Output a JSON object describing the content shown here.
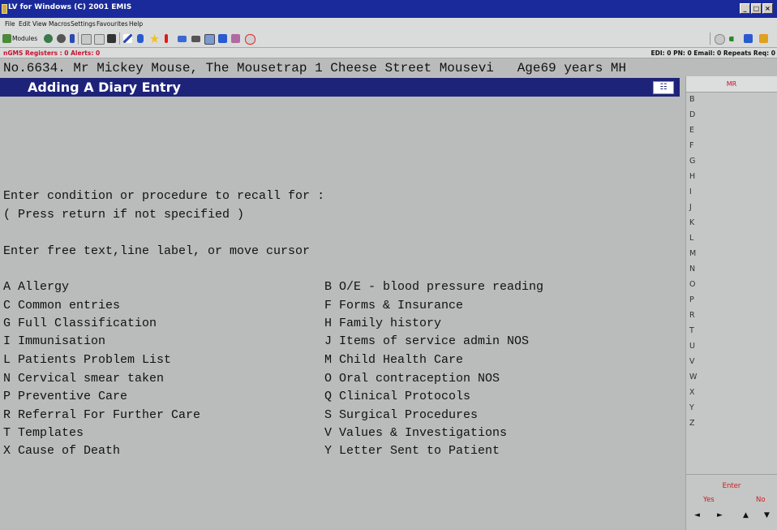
{
  "window": {
    "title": "LV for Windows (C) 2001 EMIS",
    "controls": [
      "_",
      "□",
      "×"
    ]
  },
  "menu": [
    "File",
    "Edit",
    "View",
    "Macros",
    "Settings",
    "Favourites",
    "Help"
  ],
  "toolbar": {
    "modules_label": "Modules"
  },
  "status": {
    "left": "nGMS Registers : 0  Alerts: 0",
    "right": "EDI: 0  PN: 0  Email: 0  Repeats Req: 0"
  },
  "patient_line": "No.6634. Mr Mickey Mouse, The Mousetrap 1 Cheese Street Mousevi   Age69 years MH",
  "screen": {
    "title": "Adding A Diary Entry",
    "prompt1": "Enter condition or procedure to recall for :",
    "prompt2": "( Press return if not specified )",
    "prompt3": "Enter free text,line label, or move cursor",
    "left_options": [
      "A Allergy",
      "C Common entries",
      "G Full Classification",
      "I Immunisation",
      "L Patients Problem List",
      "N Cervical smear taken",
      "P Preventive Care",
      "R Referral For Further Care",
      "T Templates",
      "X Cause of Death"
    ],
    "right_options": [
      "B O/E - blood pressure reading",
      "F Forms & Insurance",
      "H Family history",
      "J Items of service admin NOS",
      "M Child Health Care",
      "O Oral contraception NOS",
      "Q Clinical Protocols",
      "S Surgical Procedures",
      "V Values & Investigations",
      "Y Letter Sent to Patient"
    ]
  },
  "side_panel": {
    "header": "MR",
    "letters": [
      "B",
      "D",
      "E",
      "F",
      "G",
      "H",
      "I",
      "J",
      "K",
      "L",
      "M",
      "N",
      "O",
      "P",
      "R",
      "T",
      "U",
      "V",
      "W",
      "X",
      "Y",
      "Z"
    ],
    "enter_label": "Enter",
    "yes_label": "Yes",
    "no_label": "No",
    "arrows": [
      "◄",
      "►",
      "▲",
      "▼"
    ]
  }
}
